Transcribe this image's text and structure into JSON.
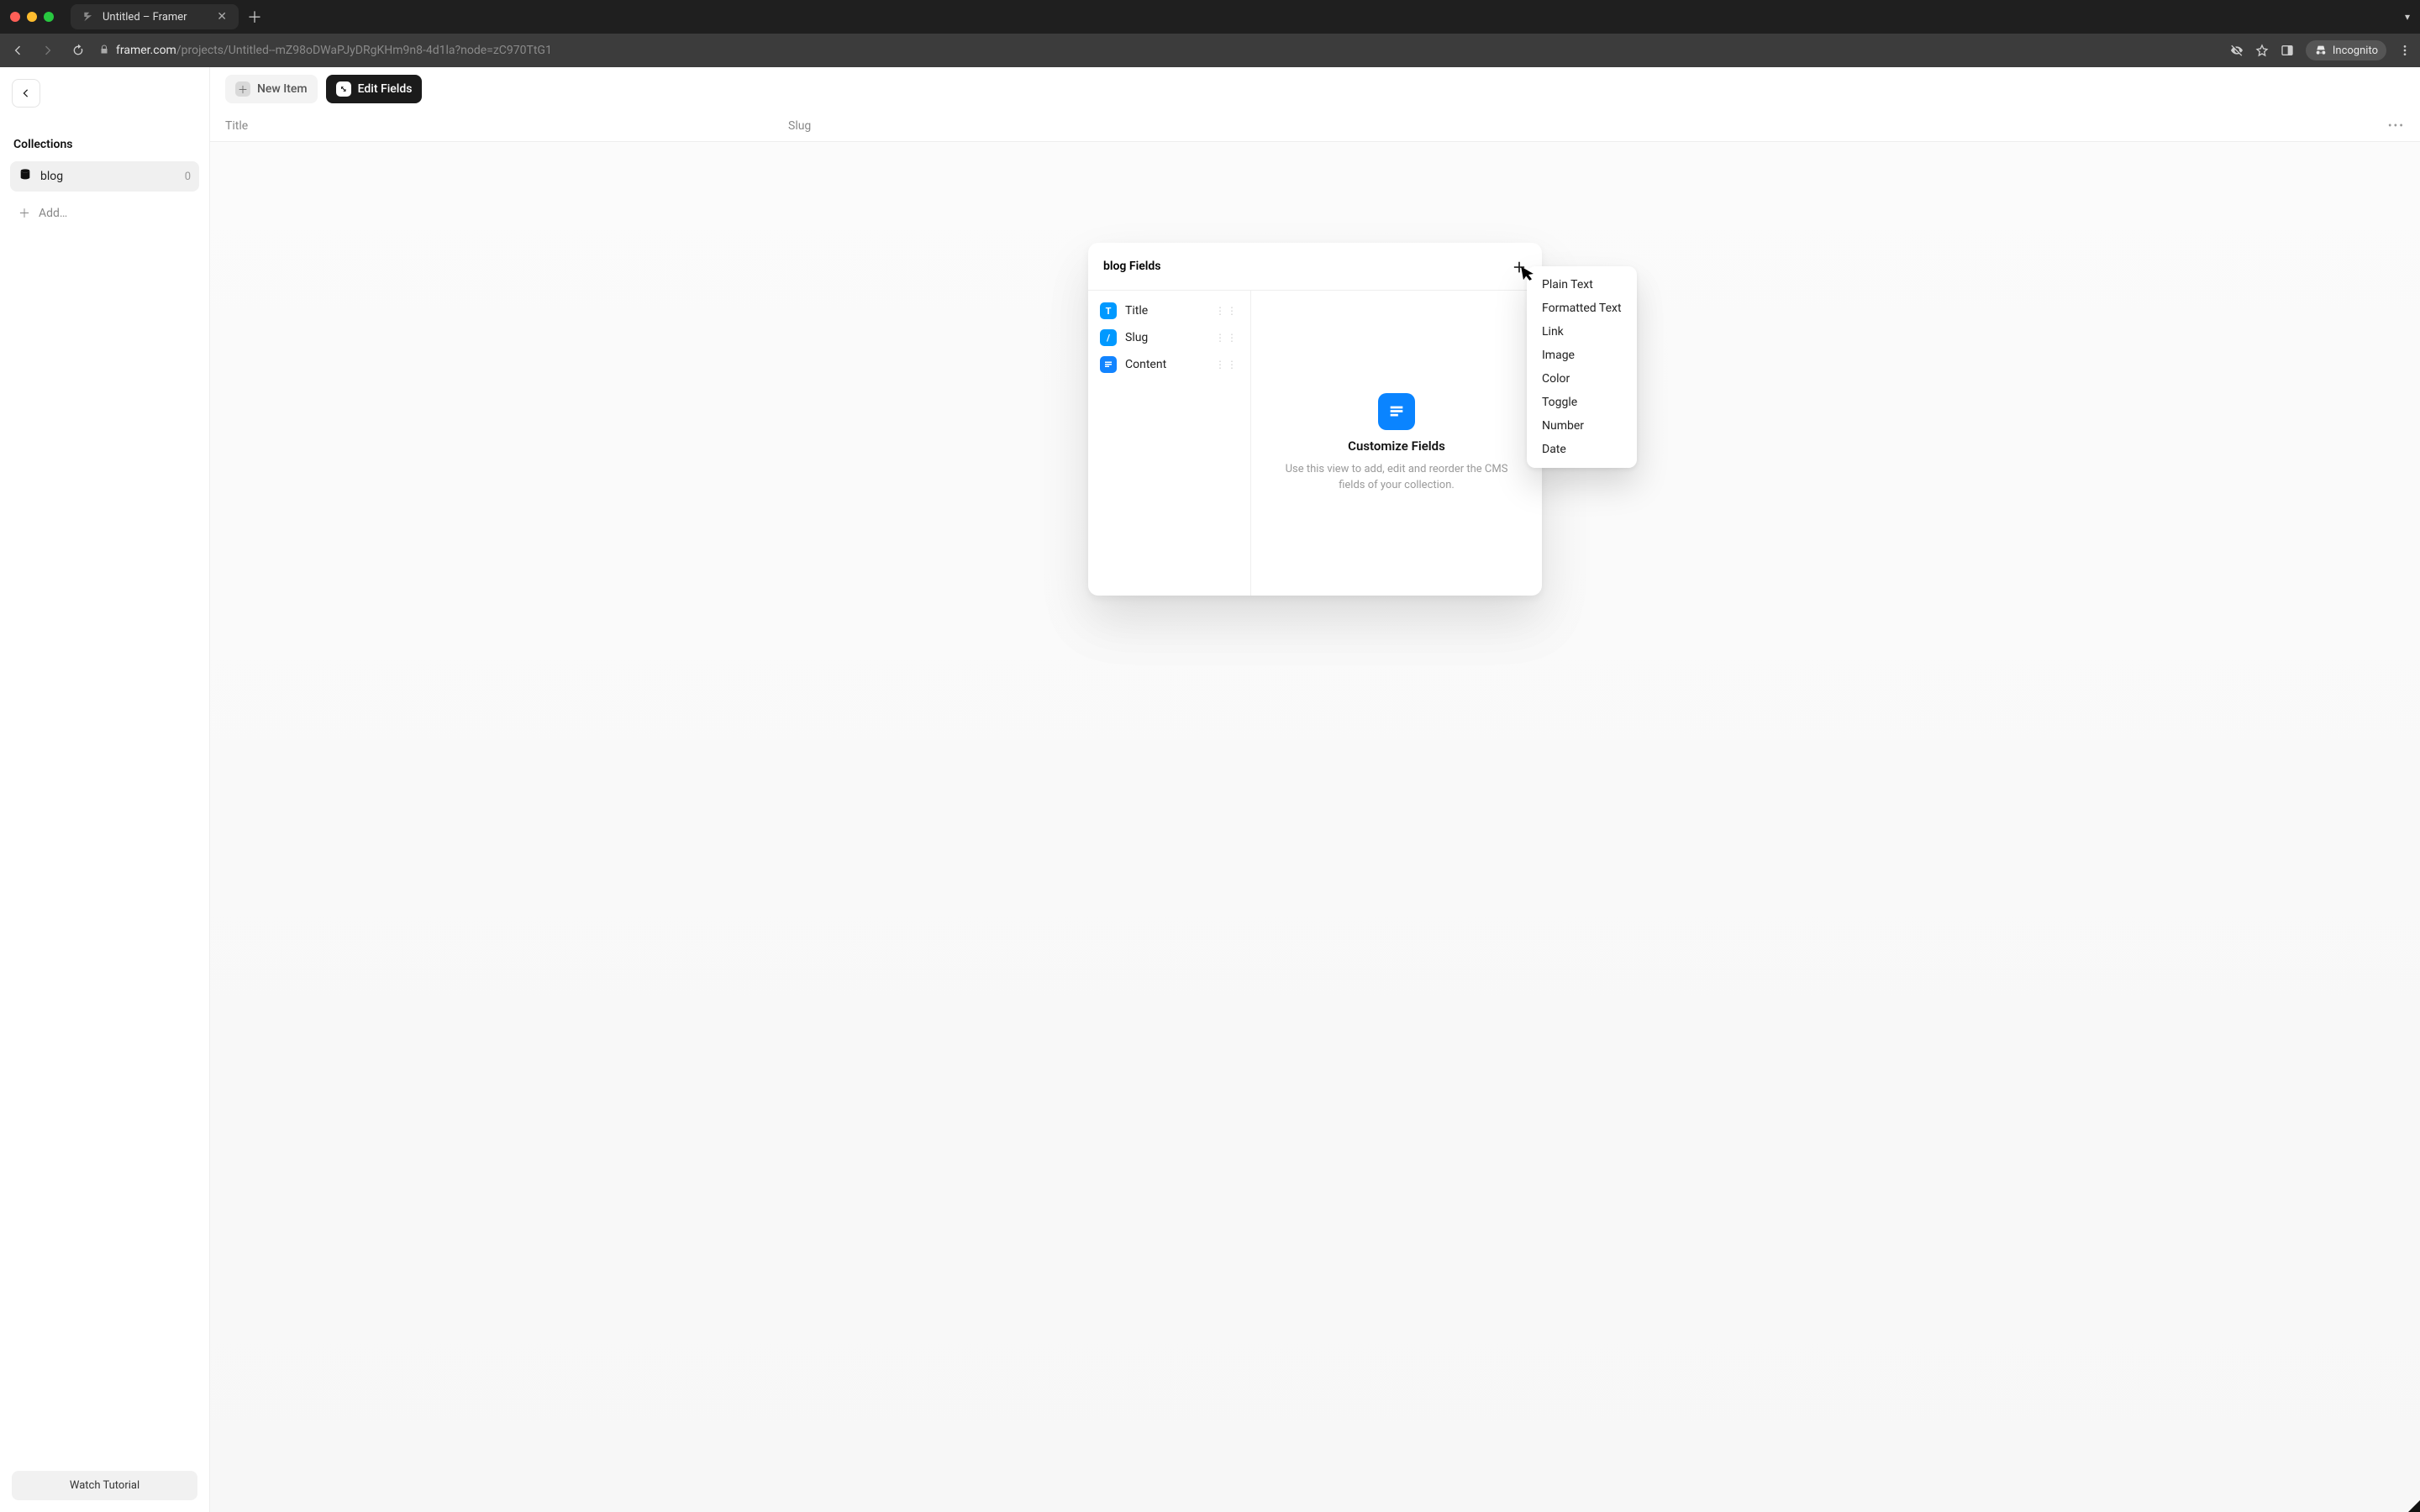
{
  "window": {
    "tab_title": "Untitled – Framer"
  },
  "browser": {
    "url_host": "framer.com",
    "url_path": "/projects/Untitled--mZ98oDWaPJyDRgKHm9n8-4d1la?node=zC970TtG1",
    "incognito_label": "Incognito"
  },
  "sidebar": {
    "back_label": "Back",
    "heading": "Collections",
    "items": [
      {
        "icon": "database-icon",
        "label": "blog",
        "count": "0",
        "active": true
      }
    ],
    "add_label": "Add…",
    "tutorial_label": "Watch Tutorial"
  },
  "topbar": {
    "new_item_label": "New Item",
    "edit_fields_label": "Edit Fields"
  },
  "table": {
    "col_title": "Title",
    "col_slug": "Slug"
  },
  "panel": {
    "title": "blog Fields",
    "fields": [
      {
        "label": "Title",
        "icon": "text-icon"
      },
      {
        "label": "Slug",
        "icon": "slug-icon"
      },
      {
        "label": "Content",
        "icon": "content-icon"
      }
    ],
    "empty_heading": "Customize Fields",
    "empty_body": "Use this view to add, edit and reorder the CMS fields of your collection."
  },
  "dropdown": {
    "options": [
      "Plain Text",
      "Formatted Text",
      "Link",
      "Image",
      "Color",
      "Toggle",
      "Number",
      "Date"
    ]
  }
}
